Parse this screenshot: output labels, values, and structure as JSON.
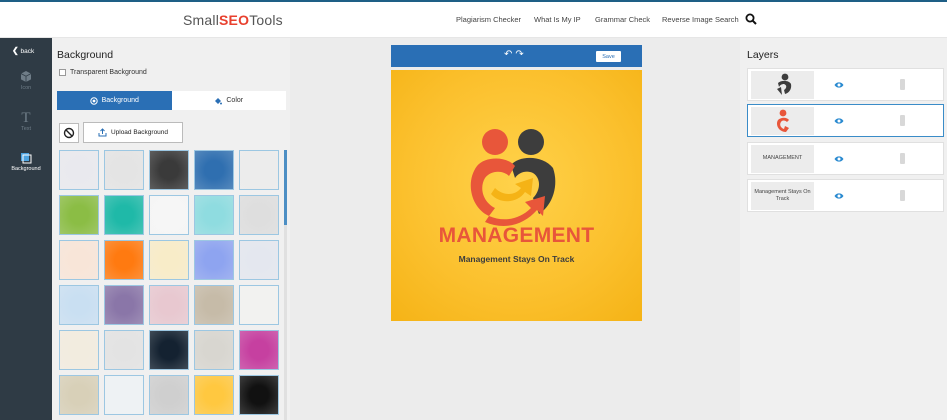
{
  "header": {
    "logo_prefix": "Small",
    "logo_seo": "SEO",
    "logo_suffix": "Tools",
    "nav": [
      "Plagiarism Checker",
      "What Is My IP",
      "Grammar Check",
      "Reverse Image Search"
    ]
  },
  "rail": {
    "back_label": "back",
    "items": [
      {
        "label": "Icon",
        "icon": "cube-icon",
        "active": false
      },
      {
        "label": "Text",
        "icon": "text-t-icon",
        "active": false
      },
      {
        "label": "Background",
        "icon": "background-icon",
        "active": true
      }
    ]
  },
  "panel": {
    "title": "Background",
    "transparent_label": "Transparent Background",
    "tabs": [
      {
        "label": "Background",
        "icon": "target-icon",
        "active": true
      },
      {
        "label": "Color",
        "icon": "paint-bucket-icon",
        "active": false
      }
    ],
    "upload_label": "Upload Background"
  },
  "swatches": [
    [
      "#e9e9ee",
      "#e4e4e4",
      "#3a3a3a",
      "#2f6fb0",
      "#ececec"
    ],
    [
      "#8bbd45",
      "#1fb9a8",
      "#f6f6f6",
      "#8fdce0",
      "#dedede"
    ],
    [
      "#f8e5d8",
      "#ff7a10",
      "#f8ecc8",
      "#8ea4f0",
      "#e4e7ef"
    ],
    [
      "#c9dff2",
      "#8a76a8",
      "#e8c8d0",
      "#c6bba8",
      "#f2f2f0"
    ],
    [
      "#f2ecdf",
      "#e3e3e3",
      "#142231",
      "#d8d6d0",
      "#c640a0"
    ],
    [
      "#d8d0b8",
      "#eef2f4",
      "#cfcfcf",
      "#ffc840",
      "#111111"
    ]
  ],
  "canvas": {
    "save_label": "Save",
    "logo_title": "MANAGEMENT",
    "logo_subtitle": "Management Stays On Track"
  },
  "layers": {
    "title": "Layers",
    "items": [
      {
        "thumb_text": "",
        "kind": "dark-figure",
        "selected": false
      },
      {
        "thumb_text": "",
        "kind": "orange-figure",
        "selected": true
      },
      {
        "thumb_text": "MANAGEMENT",
        "kind": "text",
        "selected": false
      },
      {
        "thumb_text": "Management Stays On Track",
        "kind": "text",
        "selected": false
      }
    ]
  },
  "colors": {
    "accent": "#2a6fb5",
    "rail": "#2f3b45",
    "logo_orange": "#e8563a",
    "logo_dark": "#3d3d3d",
    "artboard": "#fbc02d"
  }
}
